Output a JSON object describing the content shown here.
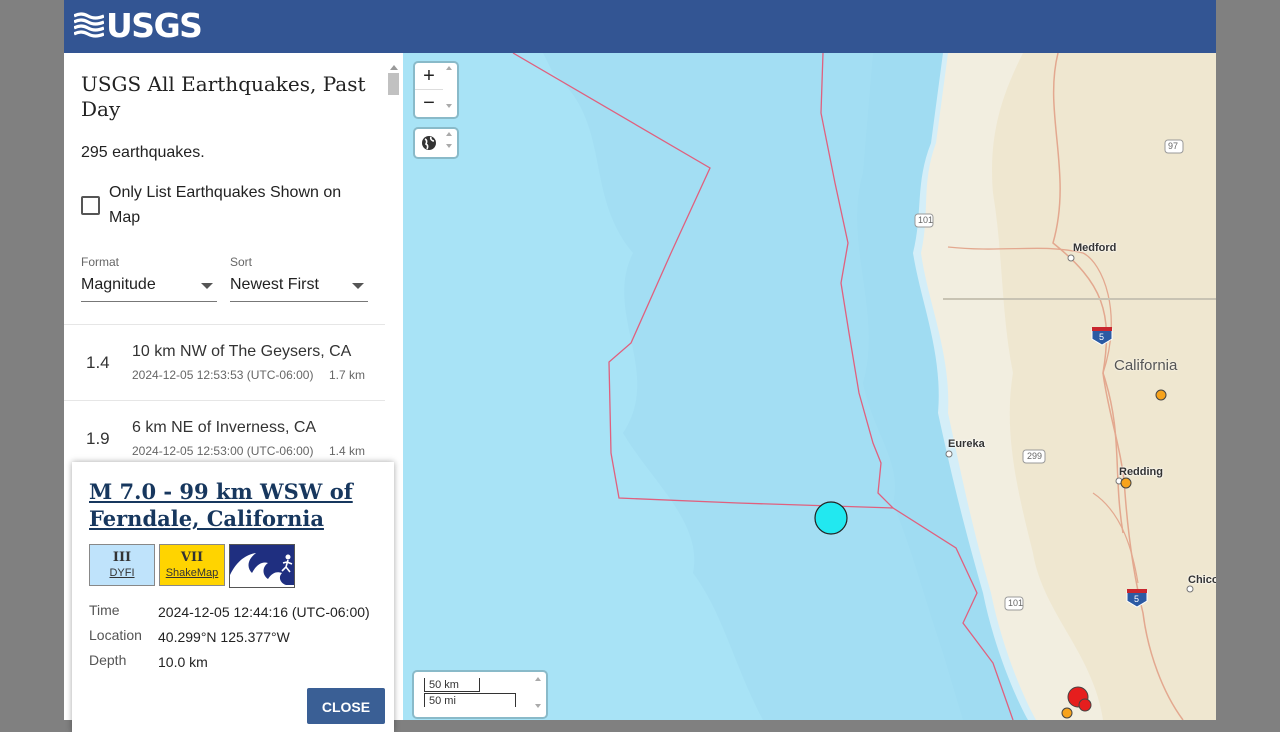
{
  "header": {
    "logo_text": "USGS",
    "logo_icon": "usgs-waves-icon"
  },
  "list": {
    "title": "USGS All Earthquakes, Past Day",
    "count": "295 earthquakes.",
    "checkbox_label": "Only List Earthquakes Shown on Map",
    "checkbox_checked": false,
    "format_label": "Format",
    "format_value": "Magnitude",
    "sort_label": "Sort",
    "sort_value": "Newest First",
    "items": [
      {
        "mag": "1.4",
        "place": "10 km NW of The Geysers, CA",
        "time": "2024-12-05 12:53:53 (UTC-06:00)",
        "depth": "1.7 km"
      },
      {
        "mag": "1.9",
        "place": "6 km NE of Inverness, CA",
        "time": "2024-12-05 12:53:00 (UTC-06:00)",
        "depth": "1.4 km"
      }
    ]
  },
  "map": {
    "zoom_in": "+",
    "zoom_out": "−",
    "layers_icon": "globe-icon",
    "cities": {
      "medford": "Medford",
      "eureka": "Eureka",
      "redding": "Redding",
      "chico": "Chico"
    },
    "state": "California",
    "shields": {
      "us101_a": "101",
      "us101_b": "101",
      "i5_a": "5",
      "i5_b": "5",
      "us97": "97",
      "ca299": "299"
    },
    "scale_km": "50 km",
    "scale_mi": "50 mi",
    "colors": {
      "ocean": "#a8e3f6",
      "land": "#f2eee0",
      "plate_boundary": "#e0607e",
      "selected_quake": "#22e8f0",
      "quake_orange": "#f7a31c",
      "quake_red": "#e61e1e"
    }
  },
  "popup": {
    "title": "M 7.0 - 99 km WSW of Ferndale, California",
    "dyfi_value": "III",
    "dyfi_label": "DYFI",
    "shakemap_value": "VII",
    "shakemap_label": "ShakeMap",
    "tsunami_icon": "tsunami-icon",
    "time_label": "Time",
    "time_value": "2024-12-05 12:44:16 (UTC-06:00)",
    "location_label": "Location",
    "location_value": "40.299°N 125.377°W",
    "depth_label": "Depth",
    "depth_value": "10.0 km",
    "close_label": "CLOSE"
  }
}
